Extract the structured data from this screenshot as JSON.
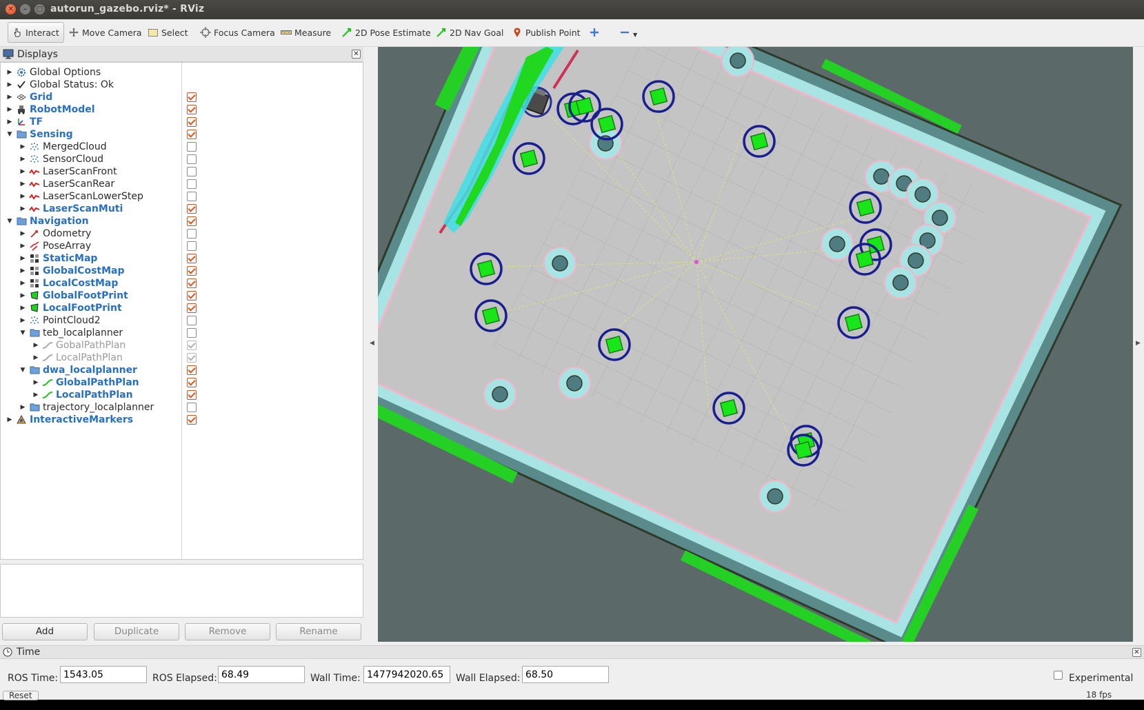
{
  "window": {
    "title": "autorun_gazebo.rviz* - RViz"
  },
  "toolbar": {
    "interact": "Interact",
    "move_camera": "Move Camera",
    "select": "Select",
    "focus_camera": "Focus Camera",
    "measure": "Measure",
    "pose_estimate": "2D Pose Estimate",
    "nav_goal": "2D Nav Goal",
    "publish_point": "Publish Point"
  },
  "displays": {
    "title": "Displays",
    "items": [
      {
        "label": "Global Options",
        "level": 0,
        "style": "normal",
        "icon": "gear-icon",
        "arrow": "right",
        "check": "none"
      },
      {
        "label": "Global Status: Ok",
        "level": 0,
        "style": "normal",
        "icon": "check-icon",
        "arrow": "right",
        "check": "none"
      },
      {
        "label": "Grid",
        "level": 0,
        "style": "blue",
        "icon": "grid-icon",
        "arrow": "right",
        "check": "on"
      },
      {
        "label": "RobotModel",
        "level": 0,
        "style": "blue",
        "icon": "robot-icon",
        "arrow": "right",
        "check": "on"
      },
      {
        "label": "TF",
        "level": 0,
        "style": "blue",
        "icon": "axes-icon",
        "arrow": "right",
        "check": "on"
      },
      {
        "label": "Sensing",
        "level": 0,
        "style": "blue",
        "icon": "folder-icon",
        "arrow": "down",
        "check": "on"
      },
      {
        "label": "MergedCloud",
        "level": 1,
        "style": "normal",
        "icon": "pointcloud-icon",
        "arrow": "right",
        "check": "off"
      },
      {
        "label": "SensorCloud",
        "level": 1,
        "style": "normal",
        "icon": "pointcloud-icon",
        "arrow": "right",
        "check": "off"
      },
      {
        "label": "LaserScanFront",
        "level": 1,
        "style": "normal",
        "icon": "laserscan-icon",
        "arrow": "right",
        "check": "off"
      },
      {
        "label": "LaserScanRear",
        "level": 1,
        "style": "normal",
        "icon": "laserscan-icon",
        "arrow": "right",
        "check": "off"
      },
      {
        "label": "LaserScanLowerStep",
        "level": 1,
        "style": "normal",
        "icon": "laserscan-icon",
        "arrow": "right",
        "check": "off"
      },
      {
        "label": "LaserScanMuti",
        "level": 1,
        "style": "blue",
        "icon": "laserscan-icon",
        "arrow": "right",
        "check": "on"
      },
      {
        "label": "Navigation",
        "level": 0,
        "style": "blue",
        "icon": "folder-icon",
        "arrow": "down",
        "check": "on"
      },
      {
        "label": "Odometry",
        "level": 1,
        "style": "normal",
        "icon": "odometry-icon",
        "arrow": "right",
        "check": "off"
      },
      {
        "label": "PoseArray",
        "level": 1,
        "style": "normal",
        "icon": "posearray-icon",
        "arrow": "right",
        "check": "off"
      },
      {
        "label": "StaticMap",
        "level": 1,
        "style": "blue",
        "icon": "map-icon",
        "arrow": "right",
        "check": "on"
      },
      {
        "label": "GlobalCostMap",
        "level": 1,
        "style": "blue",
        "icon": "map-icon",
        "arrow": "right",
        "check": "on"
      },
      {
        "label": "LocalCostMap",
        "level": 1,
        "style": "blue",
        "icon": "map-icon",
        "arrow": "right",
        "check": "on"
      },
      {
        "label": "GlobalFootPrint",
        "level": 1,
        "style": "blue",
        "icon": "polygon-icon",
        "arrow": "right",
        "check": "on"
      },
      {
        "label": "LocalFootPrint",
        "level": 1,
        "style": "blue",
        "icon": "polygon-icon",
        "arrow": "right",
        "check": "on"
      },
      {
        "label": "PointCloud2",
        "level": 1,
        "style": "normal",
        "icon": "pointcloud-icon",
        "arrow": "right",
        "check": "off"
      },
      {
        "label": "teb_localplanner",
        "level": 1,
        "style": "normal",
        "icon": "folder-icon",
        "arrow": "down",
        "check": "off"
      },
      {
        "label": "GobalPathPlan",
        "level": 2,
        "style": "grey",
        "icon": "path-icon-grey",
        "arrow": "right",
        "check": "disabled"
      },
      {
        "label": "LocalPathPlan",
        "level": 2,
        "style": "grey",
        "icon": "path-icon-grey",
        "arrow": "right",
        "check": "disabled"
      },
      {
        "label": "dwa_localplanner",
        "level": 1,
        "style": "blue",
        "icon": "folder-icon",
        "arrow": "down",
        "check": "on"
      },
      {
        "label": "GlobalPathPlan",
        "level": 2,
        "style": "blue",
        "icon": "path-icon",
        "arrow": "right",
        "check": "on"
      },
      {
        "label": "LocalPathPlan",
        "level": 2,
        "style": "blue",
        "icon": "path-icon",
        "arrow": "right",
        "check": "on"
      },
      {
        "label": "trajectory_localplanner",
        "level": 1,
        "style": "normal",
        "icon": "folder-icon",
        "arrow": "right",
        "check": "off"
      },
      {
        "label": "InteractiveMarkers",
        "level": 0,
        "style": "blue",
        "icon": "interactive-markers-icon",
        "arrow": "right",
        "check": "on"
      }
    ],
    "buttons": {
      "add": "Add",
      "duplicate": "Duplicate",
      "remove": "Remove",
      "rename": "Rename"
    }
  },
  "time": {
    "title": "Time",
    "ros_time_label": "ROS Time:",
    "ros_time": "1543.05",
    "ros_elapsed_label": "ROS Elapsed:",
    "ros_elapsed": "68.49",
    "wall_time_label": "Wall Time:",
    "wall_time": "1477942020.65",
    "wall_elapsed_label": "Wall Elapsed:",
    "wall_elapsed": "68.50",
    "experimental_label": "Experimental"
  },
  "status": {
    "reset": "Reset",
    "fps": "18 fps"
  },
  "colors": {
    "map_free": "#c3c3c3",
    "map_unknown": "#5b6a69",
    "inflation": "#a9e6e6",
    "obstacle": "#4f7c80",
    "marker": "#1a1f8f",
    "box": "#19e619",
    "lethal": "#d23c5a",
    "accent": "#2a6fc6"
  }
}
